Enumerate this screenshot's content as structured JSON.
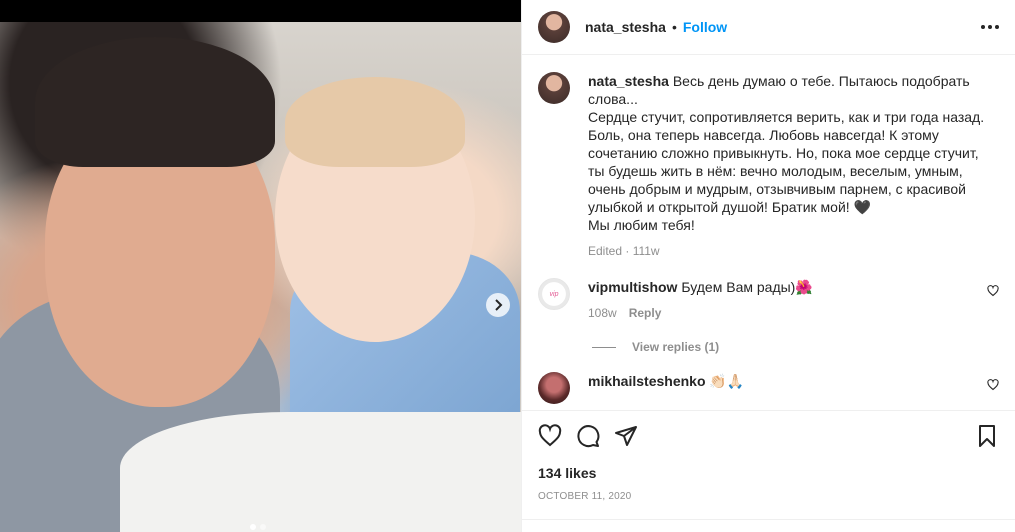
{
  "post": {
    "author": "nata_stesha",
    "separator": "•",
    "follow_label": "Follow",
    "caption_lines": [
      "Весь день думаю о тебе. Пытаюсь подобрать слова...",
      "Сердце стучит, сопротивляется верить, как и три года назад. Боль, она теперь навсегда. Любовь навсегда! К этому сочетанию сложно привыкнуть. Но, пока мое сердце стучит, ты будешь жить в нём: вечно молодым, веселым, умным, очень добрым и мудрым, отзывчивым парнем, с красивой улыбкой и открытой душой! Братик мой! 🖤",
      "Мы любим тебя!"
    ],
    "caption_meta": "Edited · 111w",
    "likes": "134 likes",
    "date": "OCTOBER 11, 2020"
  },
  "comments": [
    {
      "user": "vipmultishow",
      "text": "Будем Вам рады)🌺",
      "age": "108w",
      "reply_label": "Reply",
      "view_replies": "View replies (1)"
    },
    {
      "user": "mikhailsteshenko",
      "text": "👏🏻🙏🏻"
    }
  ],
  "media": {
    "slide_count": 2,
    "active_slide": 1
  },
  "icons": {
    "more": "more-options-icon",
    "like": "heart-icon",
    "comment": "comment-icon",
    "share": "share-icon",
    "save": "bookmark-icon",
    "next": "chevron-right-icon"
  }
}
